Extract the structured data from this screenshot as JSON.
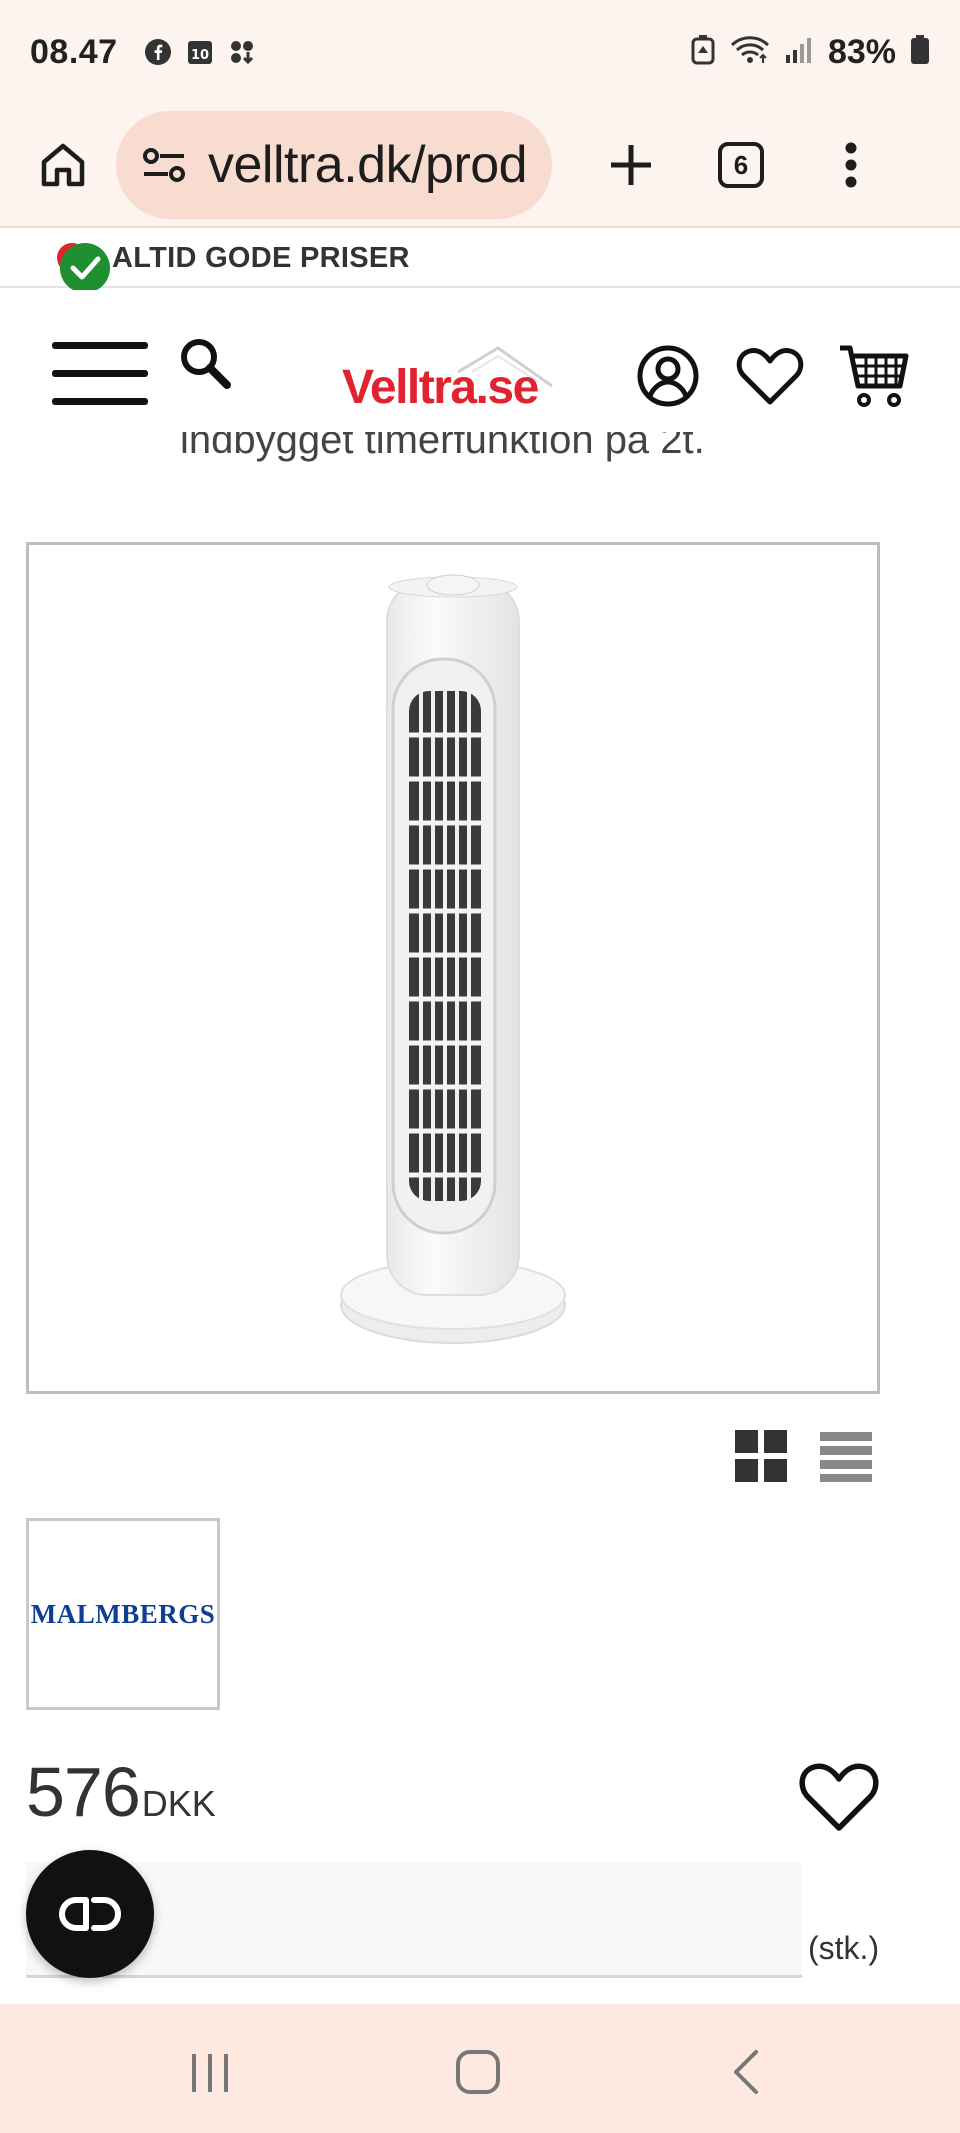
{
  "status_bar": {
    "time": "08.47",
    "notification_icons": [
      "facebook-icon",
      "calendar-icon",
      "app-download-icon"
    ],
    "calendar_badge": "10",
    "battery_percent": "83%"
  },
  "browser": {
    "url": "velltra.dk/prod",
    "tab_count": "6"
  },
  "promo": {
    "text": "ALTID GODE PRISER"
  },
  "header": {
    "logo_text": "Velltra.se",
    "icons": [
      "menu-icon",
      "search-icon",
      "account-icon",
      "wishlist-icon",
      "cart-icon"
    ]
  },
  "product": {
    "cutoff_description": "indbygget timerfunktion på 2t.",
    "image_alt": "White tower fan",
    "brand": "MALMBERGS",
    "price_amount": "576",
    "price_currency": "DKK",
    "quantity_unit": "(stk.)"
  },
  "colors": {
    "brand_red": "#e0232e",
    "chrome_bg": "#fdf3ef",
    "url_pill": "#f8dccf",
    "brand_blue": "#0d3e93"
  }
}
